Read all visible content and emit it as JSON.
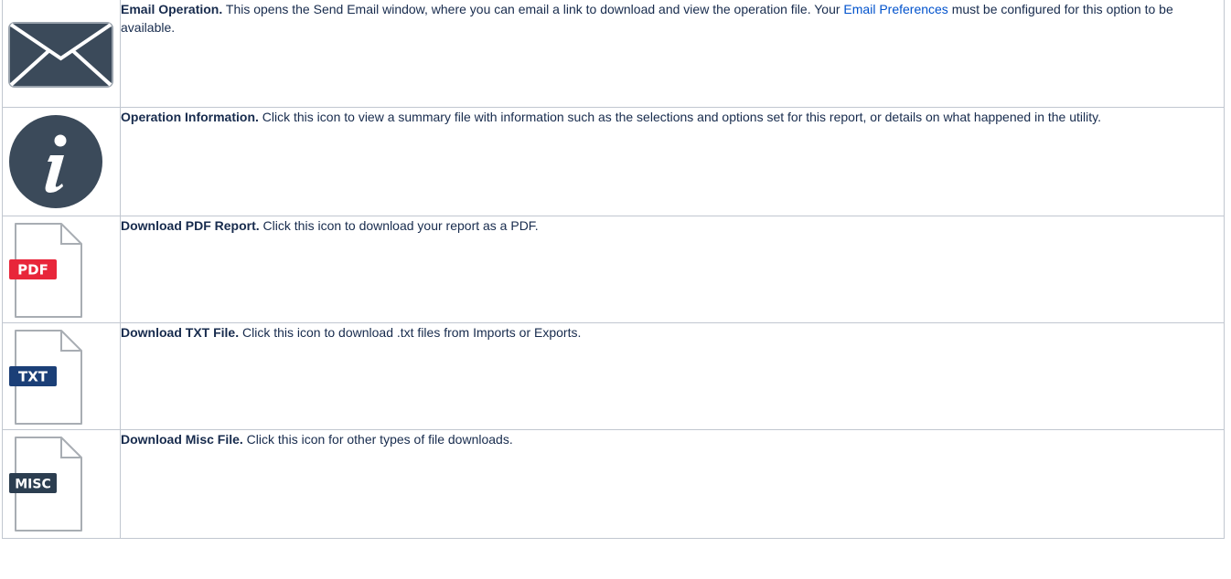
{
  "rows": [
    {
      "icon": "envelope-icon",
      "title": "Email Operation.",
      "text_before": " This opens the Send Email window, where you can email a link to download and view the operation file. Your ",
      "link": "Email Preferences",
      "text_after": " must be configured for this option to be available."
    },
    {
      "icon": "info-icon",
      "title": "Operation Information.",
      "text": " Click this icon to view a summary file with information such as the selections and options set for this report, or details on what happened in the utility."
    },
    {
      "icon": "pdf-file-icon",
      "badge": "PDF",
      "badge_color": "#e8263a",
      "title": "Download PDF Report.",
      "text": " Click this icon to download your report as a PDF."
    },
    {
      "icon": "txt-file-icon",
      "badge": "TXT",
      "badge_color": "#1b3f77",
      "title": "Download TXT File.",
      "text": " Click this icon to download .txt files from Imports or Exports."
    },
    {
      "icon": "misc-file-icon",
      "badge": "MISC",
      "badge_color": "#2c3e50",
      "title": "Download Misc File.",
      "text": " Click this icon for other types of file downloads."
    }
  ],
  "colors": {
    "icon_dark": "#3b4a5a",
    "link": "#0052cc",
    "border": "#c1c7d0"
  }
}
